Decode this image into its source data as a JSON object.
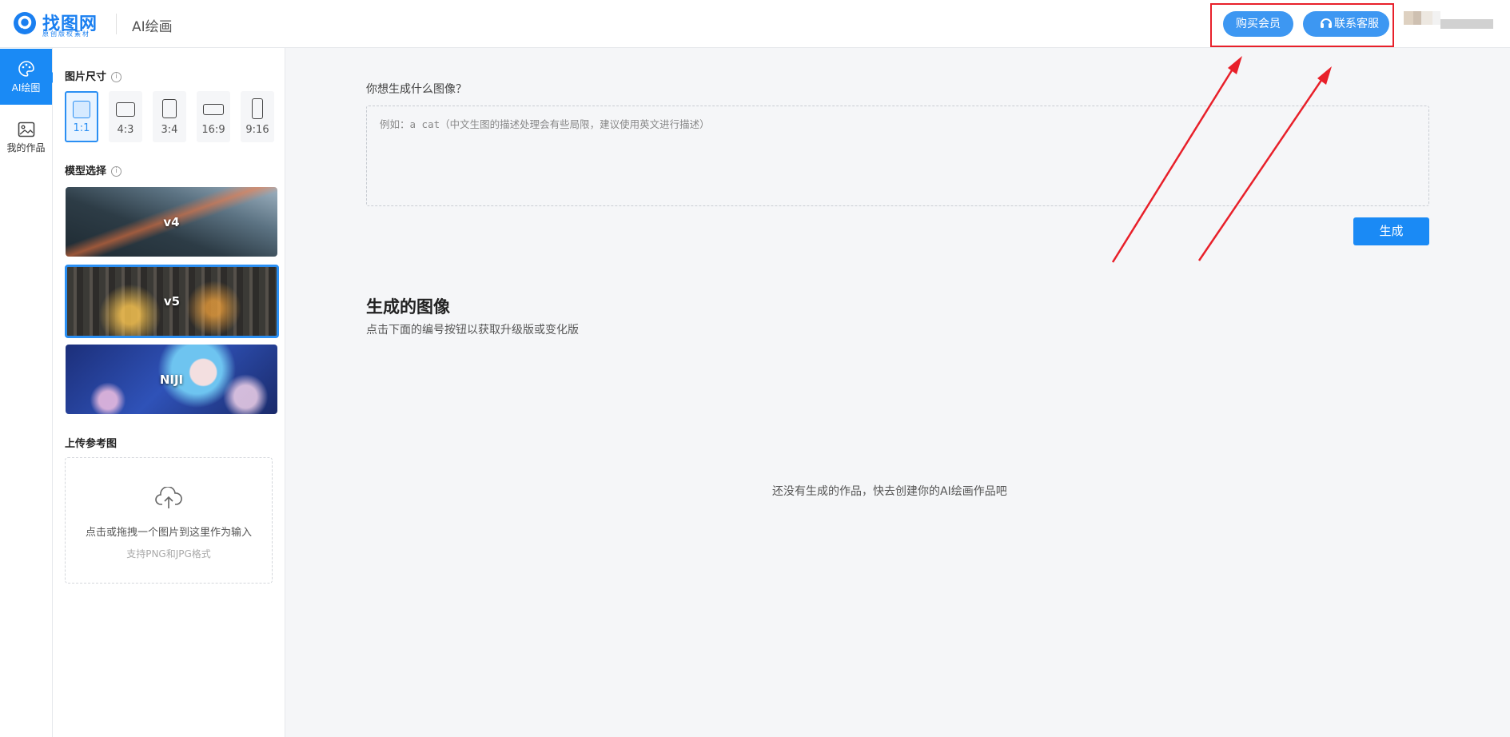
{
  "header": {
    "logo_text": "找图网",
    "logo_subtitle": "原创版权素材",
    "app_title": "AI绘画",
    "buy_label": "购买会员",
    "contact_label": "联系客服"
  },
  "rail": {
    "items": [
      {
        "label": "AI绘图",
        "icon": "palette-icon",
        "active": true
      },
      {
        "label": "我的作品",
        "icon": "image-icon",
        "active": false
      }
    ]
  },
  "panel": {
    "size_title": "图片尺寸",
    "sizes": [
      {
        "label": "1:1",
        "active": true
      },
      {
        "label": "4:3",
        "active": false
      },
      {
        "label": "3:4",
        "active": false
      },
      {
        "label": "16:9",
        "active": false
      },
      {
        "label": "9:16",
        "active": false
      }
    ],
    "model_title": "模型选择",
    "models": [
      {
        "label": "v4",
        "active": false
      },
      {
        "label": "v5",
        "active": true
      },
      {
        "label": "NIJI",
        "active": false
      }
    ],
    "upload_title": "上传参考图",
    "upload_text": "点击或拖拽一个图片到这里作为输入",
    "upload_hint": "支持PNG和JPG格式"
  },
  "main": {
    "prompt_label": "你想生成什么图像？",
    "prompt_placeholder": "例如：a cat（中文生图的描述处理会有些局限，建议使用英文进行描述）",
    "prompt_value": "",
    "generate_label": "生成",
    "gen_title": "生成的图像",
    "gen_subtitle": "点击下面的编号按钮以获取升级版或变化版",
    "empty_text": "还没有生成的作品，快去创建你的AI绘画作品吧"
  },
  "colors": {
    "accent": "#1a8af5",
    "annotation": "#e8202a"
  }
}
